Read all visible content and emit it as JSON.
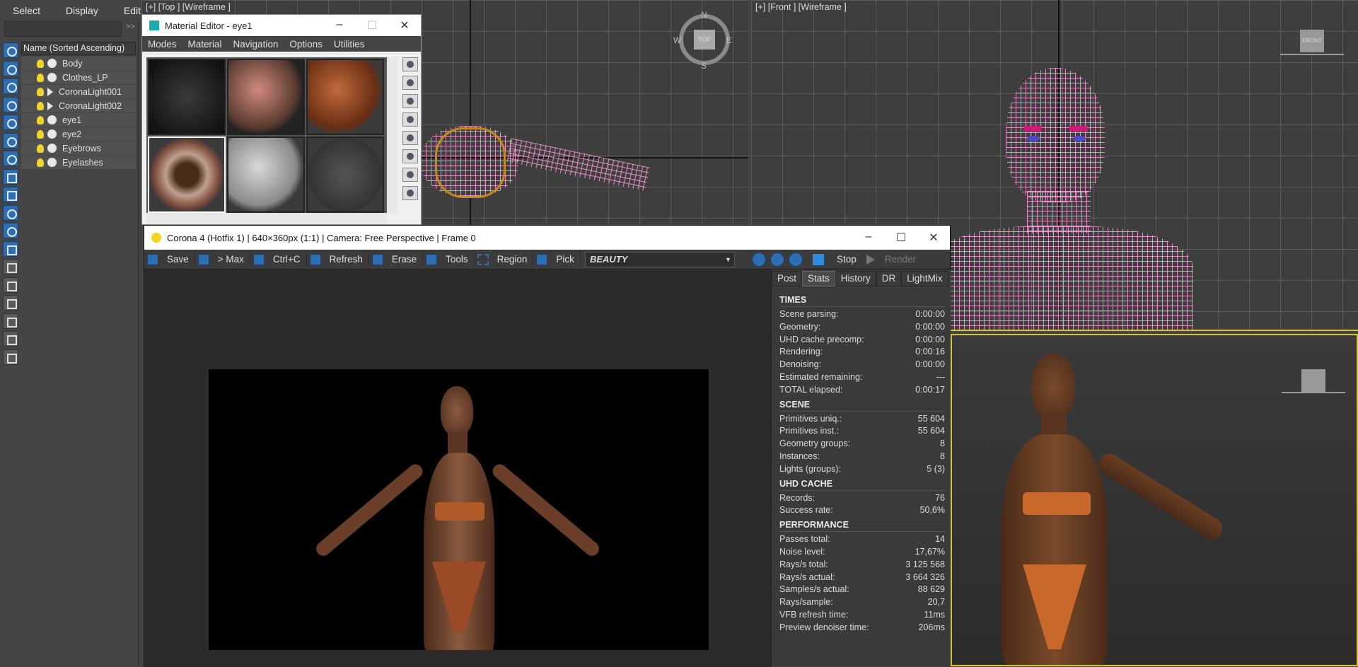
{
  "explorer": {
    "menu": [
      "Select",
      "Display",
      "Edit"
    ],
    "header": "Name (Sorted Ascending)",
    "search_arrows": ">>",
    "items": [
      {
        "label": "Body",
        "kind": "geometry"
      },
      {
        "label": "Clothes_LP",
        "kind": "geometry"
      },
      {
        "label": "CoronaLight001",
        "kind": "light"
      },
      {
        "label": "CoronaLight002",
        "kind": "light"
      },
      {
        "label": "eye1",
        "kind": "geometry"
      },
      {
        "label": "eye2",
        "kind": "geometry"
      },
      {
        "label": "Eyebrows",
        "kind": "geometry"
      },
      {
        "label": "Eyelashes",
        "kind": "geometry"
      }
    ]
  },
  "viewports": {
    "top_label": "[+] [Top ] [Wireframe ]",
    "front_label": "[+] [Front ] [Wireframe ]",
    "compass": {
      "n": "N",
      "s": "S",
      "e": "E",
      "w": "W",
      "center": "TOP"
    },
    "front_cube": "FRONT"
  },
  "material_editor": {
    "title": "Material Editor - eye1",
    "menu": [
      "Modes",
      "Material",
      "Navigation",
      "Options",
      "Utilities"
    ]
  },
  "vfb": {
    "title": "Corona 4 (Hotfix 1) | 640×360px (1:1) | Camera: Free Perspective | Frame 0",
    "toolbar": {
      "save": "Save",
      "max": "> Max",
      "copy": "Ctrl+C",
      "refresh": "Refresh",
      "erase": "Erase",
      "tools": "Tools",
      "region": "Region",
      "pick": "Pick",
      "channel": "BEAUTY",
      "stop": "Stop",
      "render": "Render"
    },
    "tabs": [
      "Post",
      "Stats",
      "History",
      "DR",
      "LightMix"
    ],
    "active_tab": "Stats",
    "stats": {
      "times_head": "TIMES",
      "times": [
        {
          "k": "Scene parsing:",
          "v": "0:00:00"
        },
        {
          "k": "Geometry:",
          "v": "0:00:00"
        },
        {
          "k": "UHD cache precomp:",
          "v": "0:00:00"
        },
        {
          "k": "Rendering:",
          "v": "0:00:16"
        },
        {
          "k": "Denoising:",
          "v": "0:00:00"
        },
        {
          "k": "Estimated remaining:",
          "v": "---"
        },
        {
          "k": "TOTAL elapsed:",
          "v": "0:00:17"
        }
      ],
      "scene_head": "SCENE",
      "scene": [
        {
          "k": "Primitives uniq.:",
          "v": "55 604"
        },
        {
          "k": "Primitives inst.:",
          "v": "55 604"
        },
        {
          "k": "Geometry groups:",
          "v": "8"
        },
        {
          "k": "Instances:",
          "v": "8"
        },
        {
          "k": "Lights (groups):",
          "v": "5 (3)"
        }
      ],
      "uhd_head": "UHD CACHE",
      "uhd": [
        {
          "k": "Records:",
          "v": "76"
        },
        {
          "k": "Success rate:",
          "v": "50,6%"
        }
      ],
      "perf_head": "PERFORMANCE",
      "perf": [
        {
          "k": "Passes total:",
          "v": "14"
        },
        {
          "k": "Noise level:",
          "v": "17,67%"
        },
        {
          "k": "Rays/s total:",
          "v": "3 125 568"
        },
        {
          "k": "Rays/s actual:",
          "v": "3 664 326"
        },
        {
          "k": "Samples/s actual:",
          "v": "88 629"
        },
        {
          "k": "Rays/sample:",
          "v": "20,7"
        },
        {
          "k": "VFB refresh time:",
          "v": "11ms"
        },
        {
          "k": "Preview denoiser time:",
          "v": "206ms"
        }
      ]
    }
  },
  "colors": {
    "accent": "#2f6db3",
    "wire": "#f5a8e0",
    "active_border": "#d8c23a"
  }
}
